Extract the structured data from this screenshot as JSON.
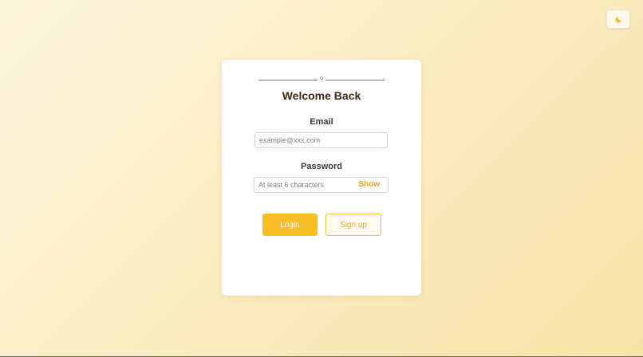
{
  "theme_toggle": {
    "icon": "moon-icon"
  },
  "card": {
    "ornament_glyph": "୨",
    "title": "Welcome Back",
    "email": {
      "label": "Email",
      "placeholder": "example@xxx.com",
      "value": ""
    },
    "password": {
      "label": "Password",
      "placeholder": "At least 6 characters",
      "value": "",
      "toggle_label": "Show"
    },
    "buttons": {
      "login_label": "Login",
      "signup_label": "Sign up"
    }
  },
  "colors": {
    "accent": "#f9bd25",
    "accent_text": "#e8a118",
    "title_text": "#3b2a14"
  }
}
